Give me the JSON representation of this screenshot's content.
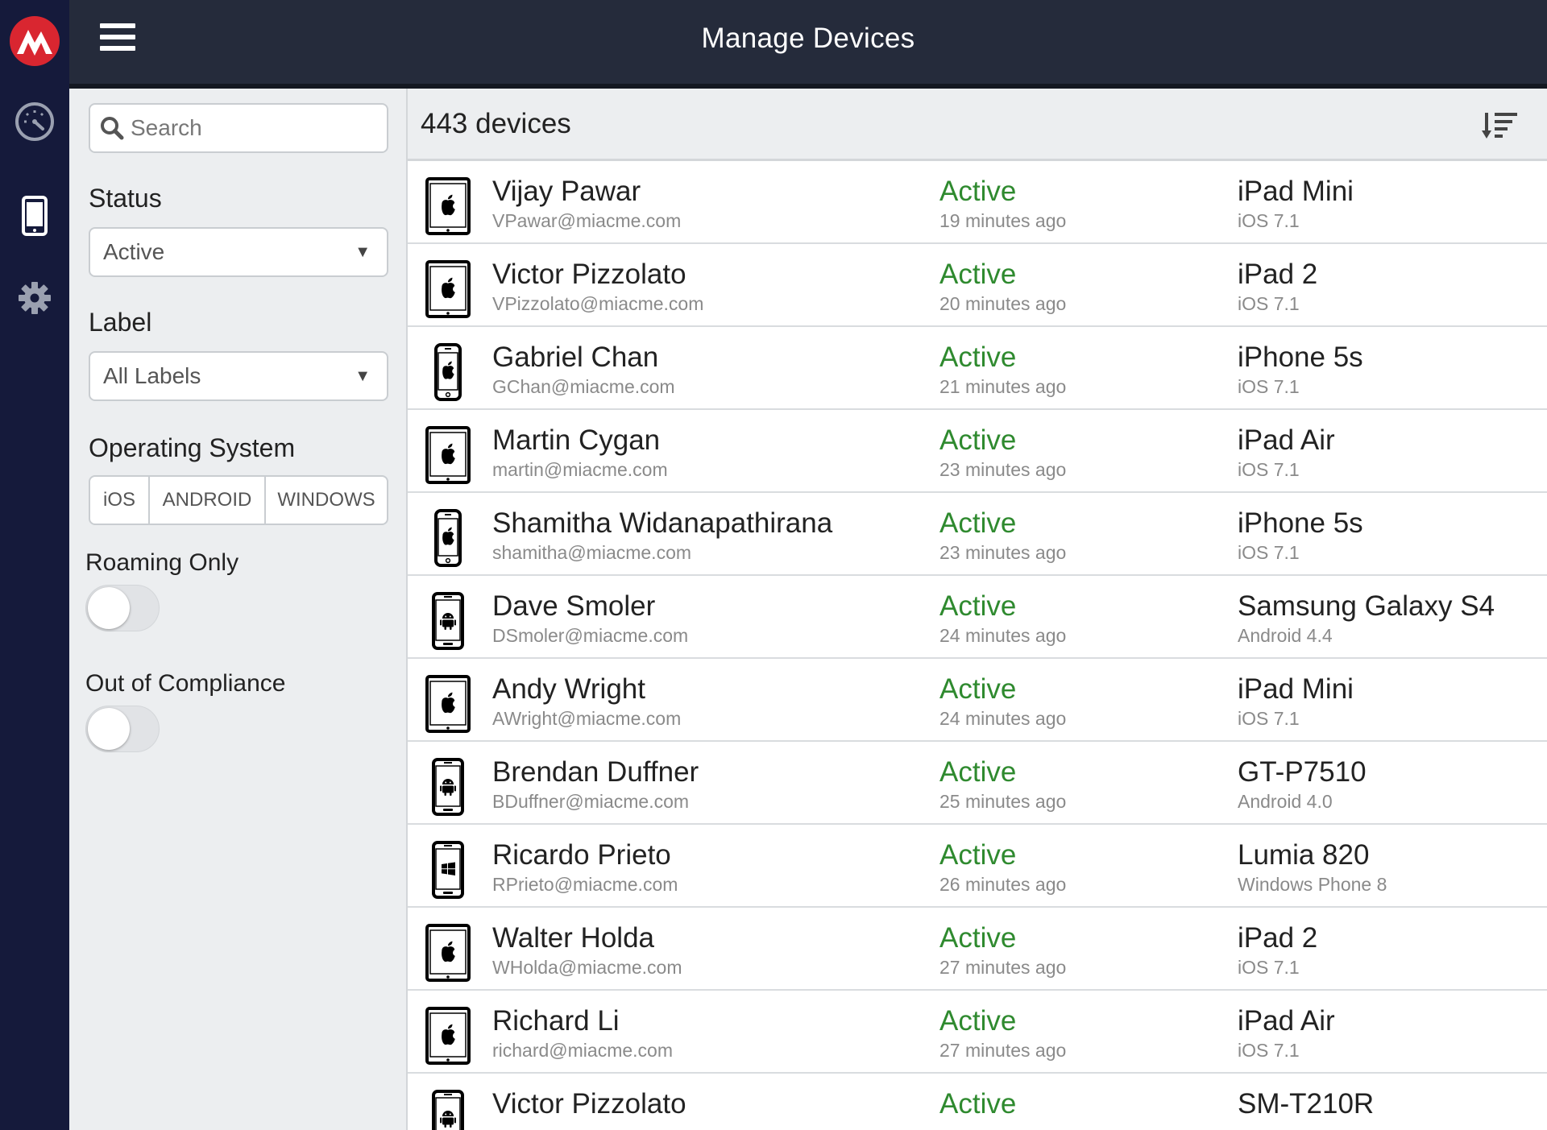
{
  "header": {
    "title": "Manage Devices"
  },
  "colors": {
    "rail": "#151a3b",
    "header": "#252b3b",
    "active_green": "#2f8a2f",
    "brand_red": "#d92630"
  },
  "icons": {
    "logo": "mobileiron-logo-icon",
    "dashboard": "speedometer-icon",
    "devices": "mobile-device-icon",
    "settings": "gear-icon",
    "menu": "hamburger-menu-icon",
    "sort": "sort-descending-icon",
    "search": "search-icon"
  },
  "filters": {
    "search_placeholder": "Search",
    "status_label": "Status",
    "status_value": "Active",
    "label_label": "Label",
    "label_value": "All Labels",
    "os_label": "Operating System",
    "os_options": [
      "iOS",
      "ANDROID",
      "WINDOWS"
    ],
    "roaming_label": "Roaming Only",
    "roaming_on": false,
    "compliance_label": "Out of Compliance",
    "compliance_on": false
  },
  "list": {
    "count_label": "443 devices",
    "rows": [
      {
        "name": "Vijay Pawar",
        "email": "VPawar@miacme.com",
        "status": "Active",
        "time": "19 minutes ago",
        "model": "iPad Mini",
        "os": "iOS 7.1",
        "device": "tablet",
        "platform": "apple"
      },
      {
        "name": "Victor Pizzolato",
        "email": "VPizzolato@miacme.com",
        "status": "Active",
        "time": "20 minutes ago",
        "model": "iPad 2",
        "os": "iOS 7.1",
        "device": "tablet",
        "platform": "apple"
      },
      {
        "name": "Gabriel Chan",
        "email": "GChan@miacme.com",
        "status": "Active",
        "time": "21 minutes ago",
        "model": "iPhone 5s",
        "os": "iOS 7.1",
        "device": "phone",
        "platform": "apple"
      },
      {
        "name": "Martin Cygan",
        "email": "martin@miacme.com",
        "status": "Active",
        "time": "23 minutes ago",
        "model": "iPad Air",
        "os": "iOS 7.1",
        "device": "tablet",
        "platform": "apple"
      },
      {
        "name": "Shamitha Widanapathirana",
        "email": "shamitha@miacme.com",
        "status": "Active",
        "time": "23 minutes ago",
        "model": "iPhone 5s",
        "os": "iOS 7.1",
        "device": "phone",
        "platform": "apple"
      },
      {
        "name": "Dave Smoler",
        "email": "DSmoler@miacme.com",
        "status": "Active",
        "time": "24 minutes ago",
        "model": "Samsung Galaxy S4",
        "os": "Android 4.4",
        "device": "phone-wide",
        "platform": "android"
      },
      {
        "name": "Andy Wright",
        "email": "AWright@miacme.com",
        "status": "Active",
        "time": "24 minutes ago",
        "model": "iPad Mini",
        "os": "iOS 7.1",
        "device": "tablet",
        "platform": "apple"
      },
      {
        "name": "Brendan Duffner",
        "email": "BDuffner@miacme.com",
        "status": "Active",
        "time": "25 minutes ago",
        "model": "GT-P7510",
        "os": "Android 4.0",
        "device": "phone-wide",
        "platform": "android"
      },
      {
        "name": "Ricardo Prieto",
        "email": "RPrieto@miacme.com",
        "status": "Active",
        "time": "26 minutes ago",
        "model": "Lumia 820",
        "os": "Windows Phone 8",
        "device": "phone-wide",
        "platform": "windows"
      },
      {
        "name": "Walter Holda",
        "email": "WHolda@miacme.com",
        "status": "Active",
        "time": "27 minutes ago",
        "model": "iPad 2",
        "os": "iOS 7.1",
        "device": "tablet",
        "platform": "apple"
      },
      {
        "name": "Richard Li",
        "email": "richard@miacme.com",
        "status": "Active",
        "time": "27 minutes ago",
        "model": "iPad Air",
        "os": "iOS 7.1",
        "device": "tablet",
        "platform": "apple"
      },
      {
        "name": "Victor Pizzolato",
        "email": "",
        "status": "Active",
        "time": "",
        "model": "SM-T210R",
        "os": "",
        "device": "phone-wide",
        "platform": "android"
      }
    ]
  }
}
